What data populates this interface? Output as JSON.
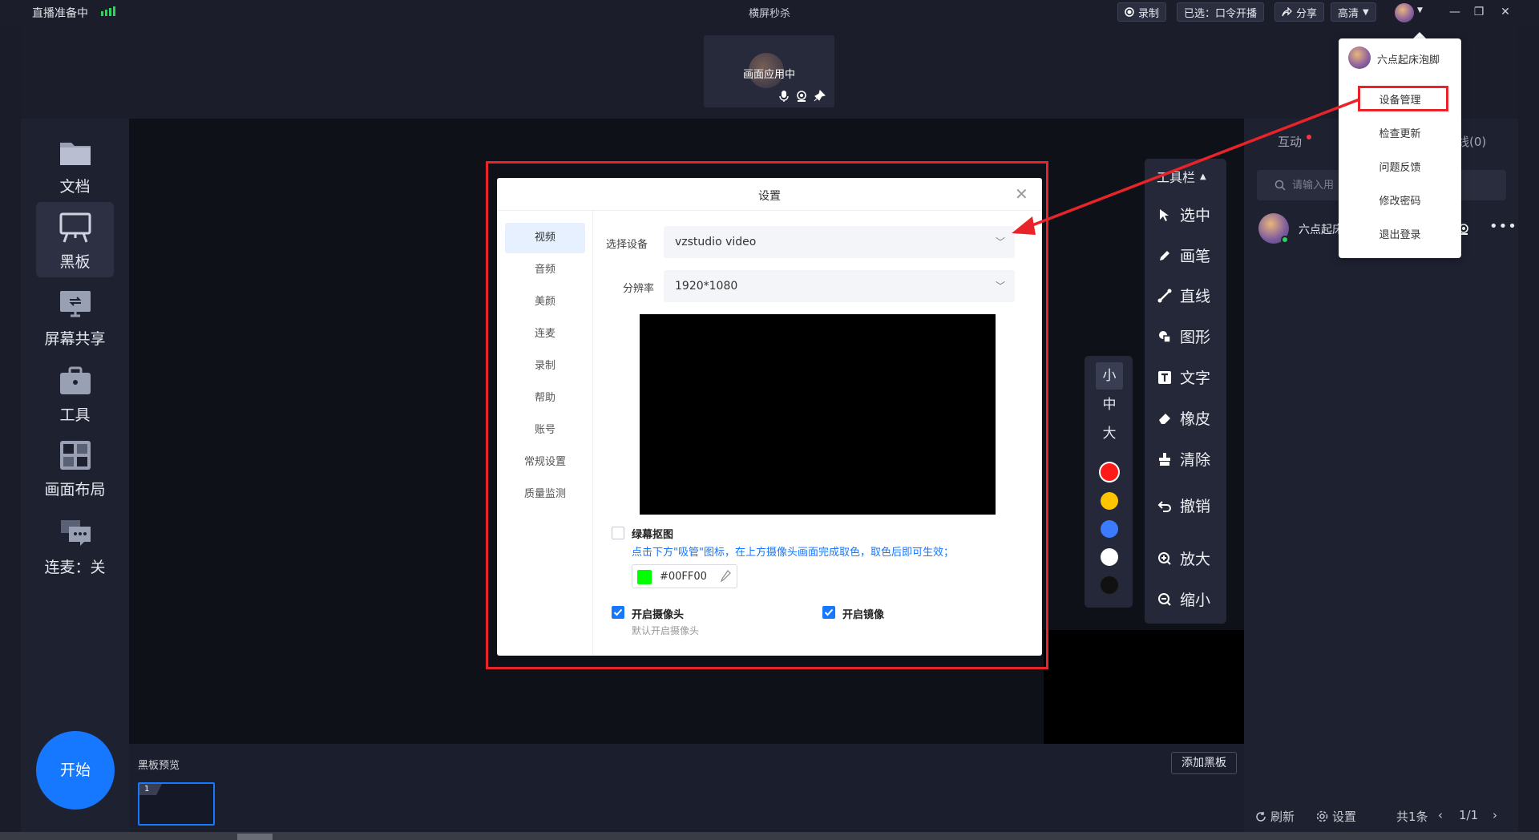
{
  "titlebar": {
    "status": "直播准备中",
    "title": "横屏秒杀",
    "record_label": "录制",
    "selected_label": "已选：口令开播",
    "share_label": "分享",
    "quality_label": "高清"
  },
  "stage": {
    "thumb_label": "画面应用中"
  },
  "sidebar": {
    "items": [
      {
        "label": "文档",
        "icon": "folder-icon"
      },
      {
        "label": "黑板",
        "icon": "blackboard-icon"
      },
      {
        "label": "屏幕共享",
        "icon": "screen-share-icon"
      },
      {
        "label": "工具",
        "icon": "toolbox-icon"
      },
      {
        "label": "画面布局",
        "icon": "layout-icon"
      },
      {
        "label": "连麦：关",
        "icon": "chat-icon"
      }
    ],
    "start_label": "开始"
  },
  "sizes": [
    "小",
    "中",
    "大"
  ],
  "colors": [
    "#ff1a1a",
    "#ffc400",
    "#3a7bff",
    "#ffffff",
    "#111111"
  ],
  "toolbar": {
    "title": "工具栏",
    "items": [
      {
        "label": "选中",
        "icon": "cursor-icon"
      },
      {
        "label": "画笔",
        "icon": "pen-icon"
      },
      {
        "label": "直线",
        "icon": "line-icon"
      },
      {
        "label": "图形",
        "icon": "shape-icon"
      },
      {
        "label": "文字",
        "icon": "text-icon"
      },
      {
        "label": "橡皮",
        "icon": "eraser-icon"
      },
      {
        "label": "清除",
        "icon": "clear-icon"
      },
      {
        "label": "撤销",
        "icon": "undo-icon"
      },
      {
        "label": "放大",
        "icon": "zoom-in-icon"
      },
      {
        "label": "缩小",
        "icon": "zoom-out-icon"
      }
    ]
  },
  "right_panel": {
    "tab_interact": "互动",
    "tab_online": "线(0)",
    "search_placeholder": "请输入用",
    "user_name": "六点起床",
    "refresh_label": "刷新",
    "settings_label": "设置",
    "total_label": "共1条",
    "page_label": "1/1"
  },
  "preview": {
    "label": "黑板预览",
    "add_label": "添加黑板",
    "thumb_number": "1"
  },
  "dialog": {
    "title": "设置",
    "nav": [
      "视频",
      "音频",
      "美颜",
      "连麦",
      "录制",
      "帮助",
      "账号",
      "常规设置",
      "质量监测"
    ],
    "device_label": "选择设备",
    "device_value": "vzstudio video",
    "resolution_label": "分辨率",
    "resolution_value": "1920*1080",
    "greenscreen_label": "绿幕抠图",
    "greenscreen_hint": "点击下方\"吸管\"图标，在上方摄像头画面完成取色，取色后即可生效；",
    "color_value": "#00FF00",
    "camera_label": "开启摄像头",
    "camera_hint": "默认开启摄像头",
    "mirror_label": "开启镜像"
  },
  "menu": {
    "user_name": "六点起床泡脚",
    "items": [
      "设备管理",
      "检查更新",
      "问题反馈",
      "修改密码",
      "退出登录"
    ]
  }
}
